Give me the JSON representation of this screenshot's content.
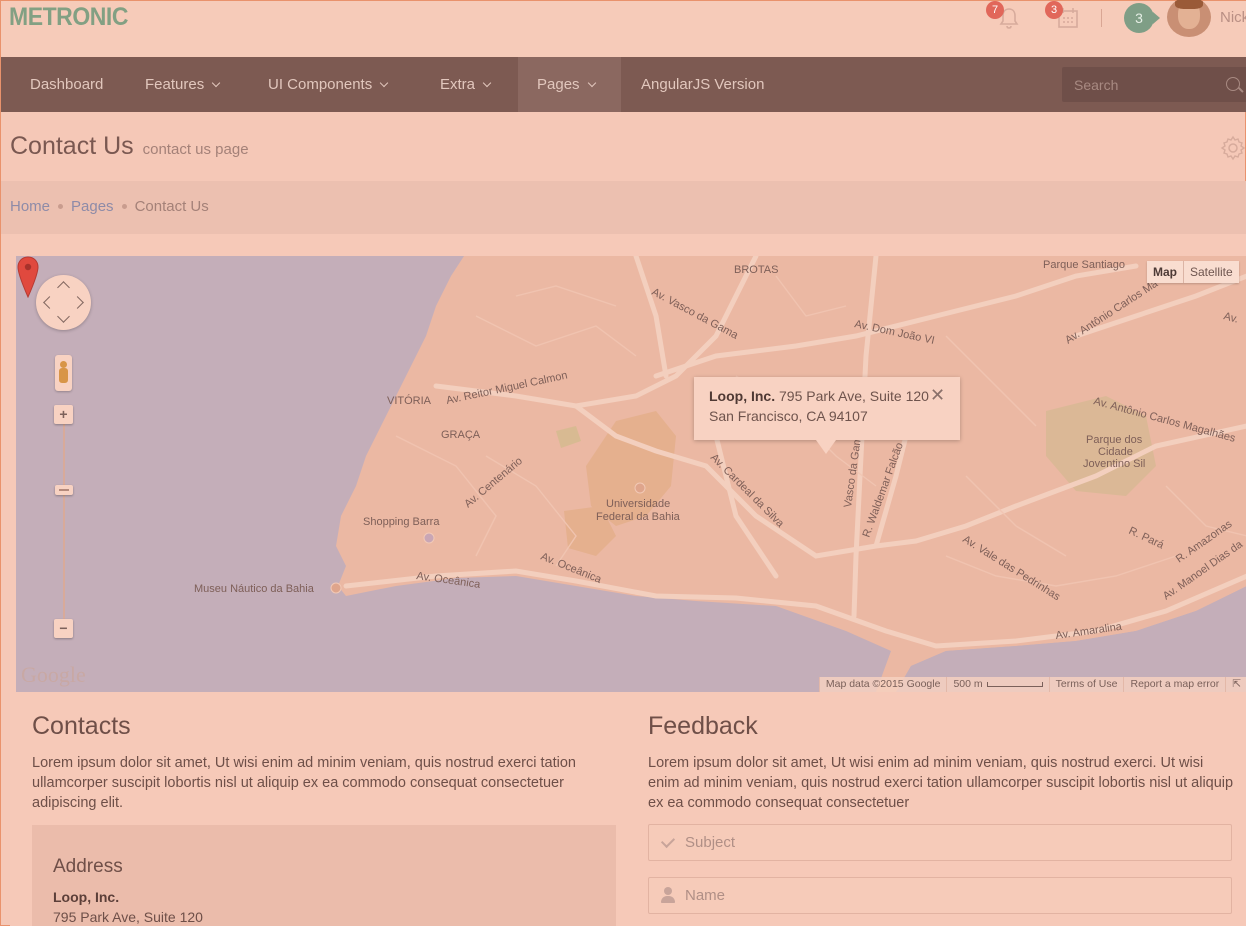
{
  "header": {
    "logo": "METRONIC",
    "notifications_count": "7",
    "calendar_count": "3",
    "messages_count": "3",
    "username": "Nick"
  },
  "nav": {
    "items": [
      {
        "label": "Dashboard"
      },
      {
        "label": "Features"
      },
      {
        "label": "UI Components"
      },
      {
        "label": "Extra"
      },
      {
        "label": "Pages"
      },
      {
        "label": "AngularJS Version"
      }
    ],
    "active": "Pages",
    "search_placeholder": "Search"
  },
  "page": {
    "title": "Contact Us",
    "subtitle": "contact us page"
  },
  "breadcrumb": {
    "items": [
      "Home",
      "Pages",
      "Contact Us"
    ]
  },
  "map": {
    "type_buttons": [
      "Map",
      "Satellite"
    ],
    "active_type": "Map",
    "info_company": "Loop, Inc.",
    "info_address_line1": "795 Park Ave, Suite 120",
    "info_address_line2": "San Francisco, CA 94107",
    "info_close": "✕",
    "zoom_in": "+",
    "zoom_out": "−",
    "google_logo": "Google",
    "footer": {
      "data": "Map data ©2015 Google",
      "scale": "500 m",
      "terms": "Terms of Use",
      "report": "Report a map error"
    },
    "labels": {
      "brotas": "BROTAS",
      "parque_santiago": "Parque Santiago",
      "vasco_da_gama": "Av. Vasco da Gama",
      "dom_joao": "Av. Dom João VI",
      "antonio_carlos_1": "Av. Antônio Carlos Ma",
      "antonio_carlos_2": "Av. Antônio Carlos Magalhães",
      "av_right": "Av.",
      "vitoria": "VITÓRIA",
      "reitor": "Av. Reitor Miguel Calmon",
      "graca": "GRAÇA",
      "centenario": "Av. Centenário",
      "universidade_1": "Universidade",
      "universidade_2": "Federal da Bahia",
      "cardeal": "Av. Cardeal da Silva",
      "vasco_gama_v": "Vasco da Gama",
      "waldemar": "R. Waldemar Falcão",
      "parque_1": "Parque dos",
      "parque_2": "Cidade",
      "parque_3": "Joventino Sil",
      "shopping": "Shopping Barra",
      "museu": "Museu Náutico da Bahia",
      "oceanica_1": "Av. Oceânica",
      "oceanica_2": "Av. Oceânica",
      "vale": "Av. Vale das Pedrinhas",
      "para": "R. Pará",
      "amazonas": "R. Amazonas",
      "manoel": "Av. Manoel Dias da",
      "amaralina": "Av. Amaralina"
    }
  },
  "contacts": {
    "title": "Contacts",
    "text": "Lorem ipsum dolor sit amet, Ut wisi enim ad minim veniam, quis nostrud exerci tation ullamcorper suscipit lobortis nisl ut aliquip ex ea commodo consequat consectetuer adipiscing elit.",
    "address_title": "Address",
    "company": "Loop, Inc.",
    "street": "795 Park Ave, Suite 120"
  },
  "feedback": {
    "title": "Feedback",
    "text": "Lorem ipsum dolor sit amet, Ut wisi enim ad minim veniam, quis nostrud exerci. Ut wisi enim ad minim veniam, quis nostrud exerci tation ullamcorper suscipit lobortis nisl ut aliquip ex ea commodo consequat consectetuer",
    "subject_placeholder": "Subject",
    "name_placeholder": "Name"
  },
  "colors": {
    "background_overlay": "#f5c8b7",
    "navbar": "#7d5a52",
    "logo": "#82a083",
    "badge": "#e1675a",
    "map_water": "#c4aeb9",
    "map_land": "#ebb8a3",
    "marker": "#e0493e"
  }
}
